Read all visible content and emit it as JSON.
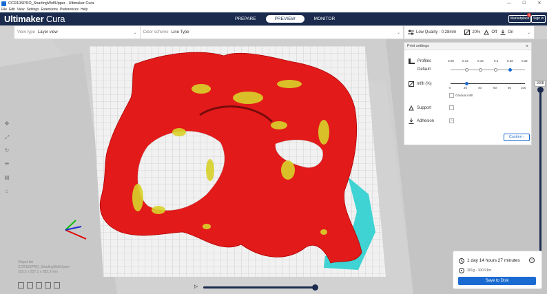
{
  "window": {
    "title": "CCR10SPRO_SnarlingWolfUpper - Ultimaker Cura",
    "controls": [
      "—",
      "☐",
      "✕"
    ]
  },
  "menu": [
    "File",
    "Edit",
    "View",
    "Settings",
    "Extensions",
    "Preferences",
    "Help"
  ],
  "header": {
    "brand_main": "Ultimaker",
    "brand_sub": "Cura",
    "stages": [
      "PREPARE",
      "PREVIEW",
      "MONITOR"
    ],
    "active_stage": "PREVIEW",
    "marketplace_label": "Marketplace",
    "marketplace_badge": "1",
    "signin_label": "Sign in"
  },
  "viewbar": {
    "view_type_label": "View type",
    "view_type_value": "Layer view",
    "color_scheme_label": "Color scheme",
    "color_scheme_value": "Line Type"
  },
  "quality": {
    "profile": "Low Quality - 0.28mm",
    "infill": "20%",
    "support": "Off",
    "adhesion": "On"
  },
  "print_settings": {
    "title": "Print settings",
    "profiles_label": "Profiles",
    "default_label": "Default",
    "layer_ticks": [
      "0.08",
      "0.12",
      "0.16",
      "0.2",
      "0.28",
      "0.32"
    ],
    "selected_layer": "0.28",
    "infill_label": "Infill (%)",
    "infill_ticks": [
      "0",
      "20",
      "40",
      "60",
      "80",
      "100"
    ],
    "infill_value": 20,
    "gradual_infill_label": "Gradual infill",
    "support_label": "Support",
    "adhesion_label": "Adhesion",
    "custom_label": "Custom"
  },
  "layer_slider": {
    "value": "1008"
  },
  "object_info": {
    "list_label": "Object list",
    "object_name": "CCR10SPRO_SnarlingWolfUpper",
    "dimensions": "252.5 x 257.1 x 282.3 mm"
  },
  "estimate": {
    "time": "1 day 14 hours 27 minutes",
    "material": "301g · 100.91m",
    "save_label": "Save to Disk"
  },
  "colors": {
    "header": "#1a2b4e",
    "accent": "#1a6bd1",
    "model": "#e31a1a",
    "infill": "#d8d22a",
    "support": "#3fd3d3"
  }
}
